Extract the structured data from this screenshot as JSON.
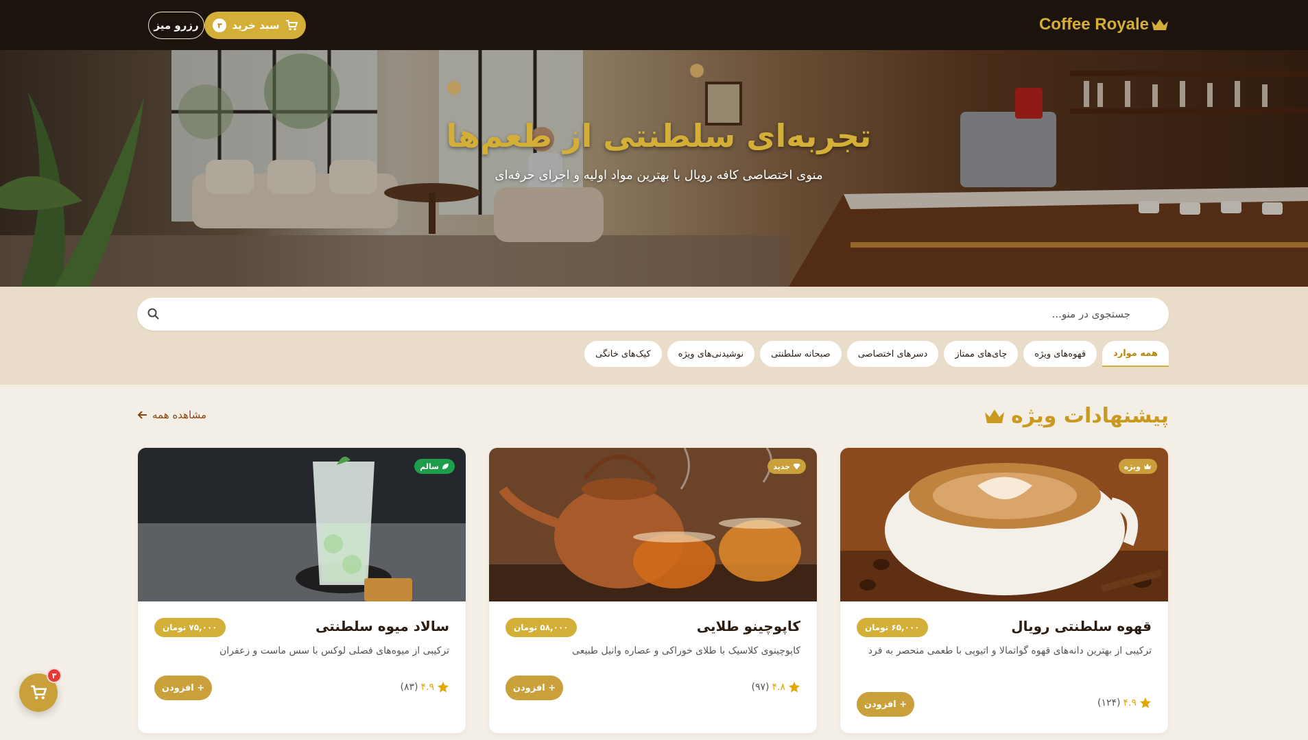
{
  "header": {
    "brand": "Coffee Royale",
    "cart_label": "سبد خرید",
    "cart_count": "۳",
    "reserve_label": "رزرو میز"
  },
  "hero": {
    "title": "تجربه‌ای سلطنتی از طعم‌ها",
    "subtitle": "منوی اختصاصی کافه رویال با بهترین مواد اولیه و اجرای حرفه‌ای"
  },
  "search": {
    "placeholder": "جستجوی در منو..."
  },
  "tabs": [
    "همه موارد",
    "قهوه‌های ویژه",
    "چای‌های ممتاز",
    "دسرهای اختصاصی",
    "صبحانه سلطنتی",
    "نوشیدنی‌های ویژه",
    "کیک‌های خانگی"
  ],
  "section": {
    "title": "پیشنهادات ویژه",
    "view_all": "مشاهده همه"
  },
  "products": [
    {
      "name": "قهوه سلطنتی رویال",
      "price": "۶۵,۰۰۰ تومان",
      "description": "ترکیبی از بهترین دانه‌های قهوه گواتمالا و اتیوپی با طعمی منحصر به فرد",
      "rating": "۴.۹",
      "reviews": "(۱۲۴)",
      "badge": "ویژه",
      "add_label": "+ افزودن",
      "badge_color": "#c9a03a"
    },
    {
      "name": "کاپوچینو طلایی",
      "price": "۵۸,۰۰۰ تومان",
      "description": "کاپوچینوی کلاسیک با طلای خوراکی و عصاره وانیل طبیعی",
      "rating": "۴.۸",
      "reviews": "(۹۷)",
      "badge": "جدید",
      "add_label": "+ افزودن",
      "badge_color": "#c9a03a"
    },
    {
      "name": "سالاد میوه سلطنتی",
      "price": "۷۵,۰۰۰ تومان",
      "description": "ترکیبی از میوه‌های فصلی لوکس با سس ماست و زعفران",
      "rating": "۴.۹",
      "reviews": "(۸۳)",
      "badge": "سالم",
      "add_label": "+ افزودن",
      "badge_color": "#1e9e4a"
    }
  ],
  "floating_cart": {
    "count": "۳"
  },
  "colors": {
    "gold": "#d4af37",
    "dark": "#1d130d",
    "cream": "#f4efe6",
    "band": "#e9dcc8"
  }
}
